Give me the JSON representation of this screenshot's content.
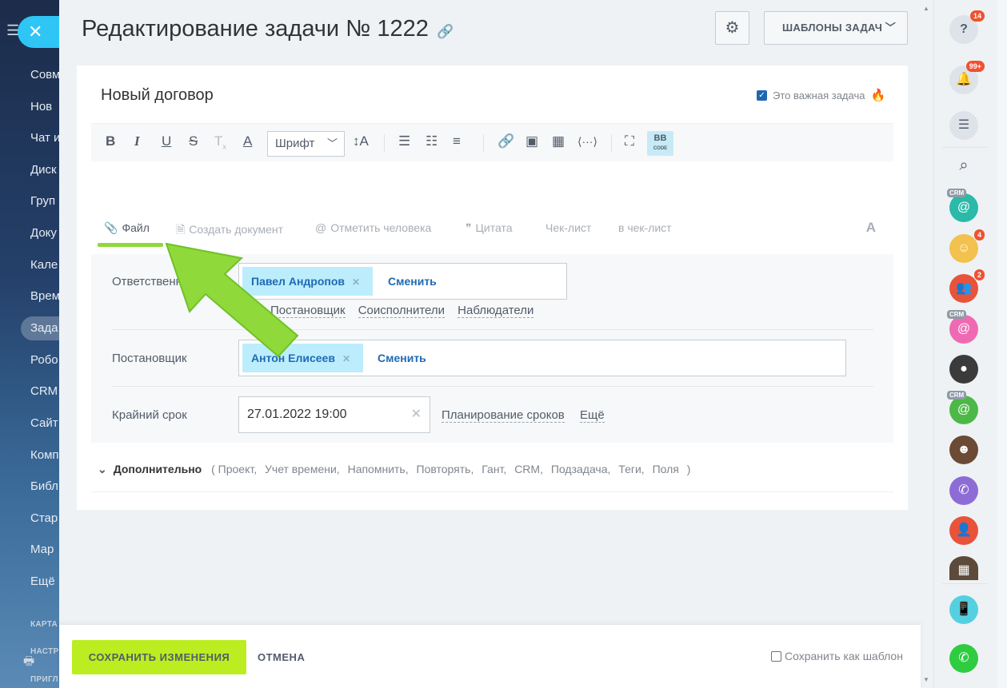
{
  "left_sidebar": {
    "items": [
      "Совм",
      "Нов",
      "Чат и",
      "Диск",
      "Груп",
      "Доку",
      "Кале",
      "Врем",
      "Зада",
      "Робо",
      "CRM",
      "Сайт",
      "Комп",
      "Библ",
      "Стар",
      "Мар",
      "Ещё"
    ],
    "active_index": 8,
    "section_1": "КАРТА",
    "section_2": "НАСТР",
    "section_3": "ПРИГЛ"
  },
  "header": {
    "title": "Редактирование задачи № 1222",
    "templates_label": "ШАБЛОНЫ ЗАДАЧ"
  },
  "task": {
    "name": "Новый договор",
    "important_label": "Это важная задача",
    "important_checked": true
  },
  "toolbar": {
    "font_select": "Шрифт",
    "bbcode_label": "BB",
    "bbcode_sub": "CODE"
  },
  "editor_actions": {
    "file": "Файл",
    "create_doc": "Создать документ",
    "mention": "Отметить человека",
    "quote": "Цитата",
    "checklist": "Чек-лист",
    "to_checklist": "в чек-лист"
  },
  "fields": {
    "responsible_label": "Ответственный",
    "responsible_user": "Павел Андропов",
    "change_label": "Сменить",
    "roles": [
      "Постановщик",
      "Соисполнители",
      "Наблюдатели"
    ],
    "creator_label": "Постановщик",
    "creator_user": "Антон Елисеев",
    "deadline_label": "Крайний срок",
    "deadline_value": "27.01.2022 19:00",
    "plan_label": "Планирование сроков",
    "more_label": "Ещё"
  },
  "extra": {
    "label": "Дополнительно",
    "items": [
      "Проект,",
      "Учет времени,",
      "Напомнить,",
      "Повторять,",
      "Гант,",
      "CRM,",
      "Подзадача,",
      "Теги,",
      "Поля"
    ]
  },
  "footer": {
    "save_label": "СОХРАНИТЬ ИЗМЕНЕНИЯ",
    "cancel_label": "ОТМЕНА",
    "save_template_label": "Сохранить как шаблон"
  },
  "right_rail": {
    "help_badge": "14",
    "notify_badge": "99+",
    "crm_tag": "CRM",
    "avatar_badge_1": "4",
    "avatar_badge_2": "2"
  },
  "colors": {
    "accent_blue": "#2fc6f6",
    "save_green": "#bbed21",
    "annotation_green": "#8fd93b",
    "chip_bg": "#bcedfc",
    "link_blue": "#1f6ab5"
  }
}
